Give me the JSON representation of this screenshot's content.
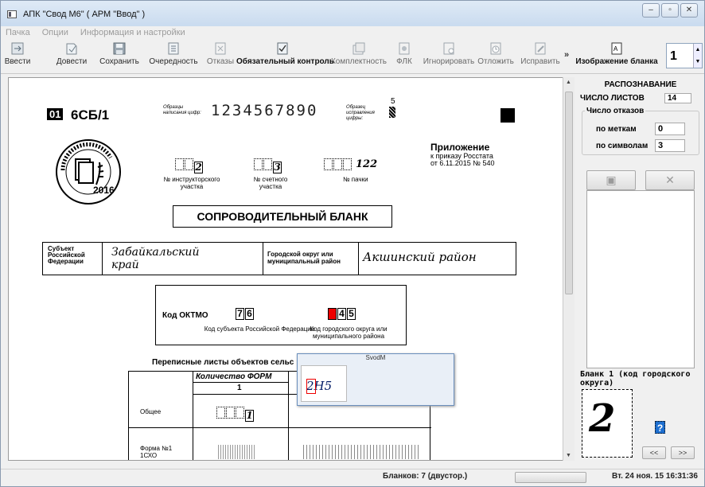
{
  "window": {
    "title": "АПК \"Свод М6\"  ( АРМ \"Ввод\" )",
    "controls": [
      "minimize",
      "maximize",
      "close"
    ]
  },
  "menu": [
    "Пачка",
    "Опции",
    "Информация и настройки"
  ],
  "toolbar": {
    "buttons": [
      {
        "label": "Ввести",
        "icon": "enter-icon",
        "enabled": true
      },
      {
        "label": "Довести",
        "icon": "complete-icon",
        "enabled": true
      },
      {
        "label": "Сохранить",
        "icon": "save-icon",
        "enabled": true
      },
      {
        "label": "Очередность",
        "icon": "queue-icon",
        "enabled": true
      },
      {
        "label": "Отказы",
        "icon": "rejects-icon",
        "enabled": false
      },
      {
        "label": "Обязательный контроль",
        "icon": "control-icon",
        "enabled": true
      },
      {
        "label": "Комплектность",
        "icon": "completeness-icon",
        "enabled": false
      },
      {
        "label": "ФЛК",
        "icon": "flk-icon",
        "enabled": false
      },
      {
        "label": "Игнорировать",
        "icon": "ignore-icon",
        "enabled": false
      },
      {
        "label": "Отложить",
        "icon": "postpone-icon",
        "enabled": false
      },
      {
        "label": "Исправить",
        "icon": "fix-icon",
        "enabled": false
      }
    ],
    "overflow": "»",
    "image_button": "Изображение бланка",
    "page_value": "1"
  },
  "form": {
    "code_badge": "01",
    "form_code": "6СБ/1",
    "sample_label": "Образцы написания цифр:",
    "sample_digits": "1234567890",
    "sample_fix_label": "Образец исправления цифры:",
    "sample_fix_digit": "5",
    "seal_year": "2016",
    "appendix_title": "Приложение",
    "appendix_line1": "к приказу Росстата",
    "appendix_line2": "от 6.11.2015 № 540",
    "field1_value": "2",
    "field1_label": "№ инструкторского участка",
    "field2_value": "3",
    "field2_label": "№ счетного участка",
    "field3_value": "122",
    "field3_label": "№ пачки",
    "doc_title": "СОПРОВОДИТЕЛЬНЫЙ БЛАНК",
    "subject_label": "Субъект Российской Федерации",
    "subject_value": "Забайкальский край",
    "district_label": "Городской округ или муниципальный район",
    "district_value": "Акшинский район",
    "oktmo_label": "Код ОКТМО",
    "oktmo_subject_digits": [
      "7",
      "6"
    ],
    "oktmo_district_digits": [
      "?",
      "4",
      "5"
    ],
    "oktmo_subject_caption": "Код субъекта Российской Федерации",
    "oktmo_district_caption": "Код городского округа или муниципального района",
    "table_title": "Переписные листы объектов сельс",
    "table_col": "Количество ФОРМ",
    "table_col_num": "1",
    "row1_label": "Общее",
    "row1_value": "1",
    "row2_label": "Форма №1 1СХО"
  },
  "popup": {
    "title": "SvodM",
    "value": "2Н5"
  },
  "recognition": {
    "header": "РАСПОЗНАВАНИЕ",
    "sheets_label": "ЧИСЛО ЛИСТОВ",
    "sheets_value": "14",
    "rejects_label": "Число отказов",
    "by_marks_label": "по меткам",
    "by_marks_value": "0",
    "by_symbols_label": "по символам",
    "by_symbols_value": "3",
    "form_caption": "Бланк 1 (код городского округа)",
    "crop_value": "2",
    "char_value": "?",
    "prev": "<<",
    "next": ">>"
  },
  "status": {
    "blanks": "Бланков: 7 (двустор.)",
    "datetime": "Вт. 24 ноя. 15 16:31:36"
  }
}
